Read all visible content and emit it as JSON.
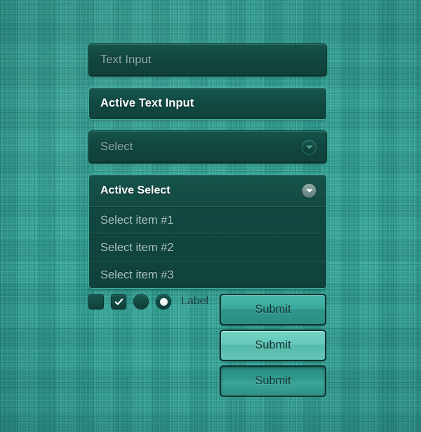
{
  "theme": {
    "background_color": "#2ea396",
    "field_fill": "#11463f",
    "accent_border": "#3fb5a5",
    "button_normal": "#3aa99c",
    "button_hover": "#63c8b9",
    "button_pressed": "#339a8f",
    "placeholder_color": "#8fada7",
    "value_color": "#ffffff",
    "label_color": "#143b37"
  },
  "form": {
    "text_input": {
      "placeholder": "Text Input",
      "value": ""
    },
    "active_text_input": {
      "value": "Active Text Input"
    },
    "select": {
      "placeholder": "Select",
      "caret_icon": "chevron-down-icon"
    },
    "active_select": {
      "value": "Active Select",
      "caret_icon": "chevron-down-icon",
      "options": [
        "Select item #1",
        "Select item #2",
        "Select item #3"
      ]
    }
  },
  "controls": {
    "checkbox_unchecked": {
      "icon": "checkbox-icon",
      "checked": false
    },
    "checkbox_checked": {
      "icon": "check-icon",
      "checked": true
    },
    "radio_unselected": {
      "icon": "radio-icon",
      "selected": false
    },
    "radio_selected": {
      "icon": "radio-dot-icon",
      "selected": true
    },
    "label": "Label"
  },
  "buttons": [
    {
      "label": "Submit",
      "state": "normal"
    },
    {
      "label": "Submit",
      "state": "hover"
    },
    {
      "label": "Submit",
      "state": "pressed"
    }
  ]
}
